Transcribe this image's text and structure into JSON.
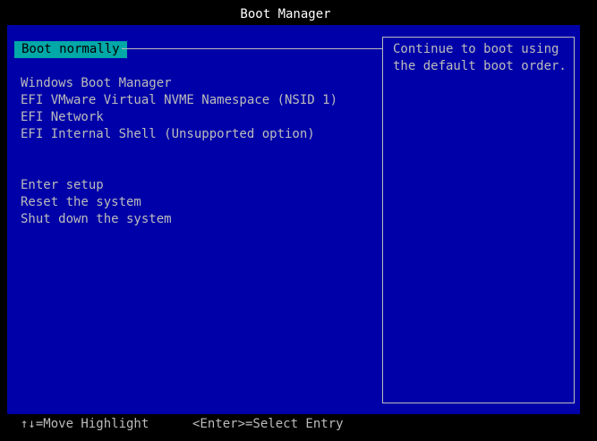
{
  "header": {
    "title": "Boot Manager"
  },
  "menu": {
    "boot_normally": "Boot normally",
    "devices": [
      "Windows Boot Manager",
      "EFI VMware Virtual NVME Namespace (NSID 1)",
      "EFI Network",
      "EFI Internal Shell (Unsupported option)"
    ],
    "actions": [
      "Enter setup",
      "Reset the system",
      "Shut down the system"
    ]
  },
  "help": {
    "text": "Continue to boot using the default boot order."
  },
  "footer": {
    "move_highlight": "↑↓=Move Highlight",
    "select_entry": "<Enter>=Select Entry"
  },
  "colors": {
    "background": "#0000a8",
    "highlight": "#00a8a8",
    "text": "#bcbcbc",
    "title": "#ffffff",
    "outer": "#000000"
  }
}
